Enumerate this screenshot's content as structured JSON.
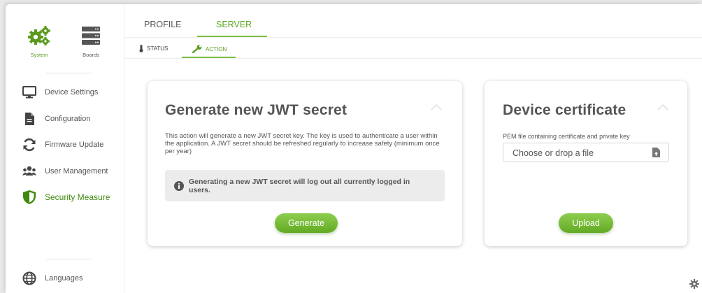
{
  "sidebar": {
    "system_label": "System",
    "boards_label": "Boards",
    "items": [
      {
        "label": "Device Settings",
        "icon": "monitor-icon"
      },
      {
        "label": "Configuration",
        "icon": "document-icon"
      },
      {
        "label": "Firmware Update",
        "icon": "refresh-icon"
      },
      {
        "label": "User Management",
        "icon": "users-icon"
      },
      {
        "label": "Security Measure",
        "icon": "shield-icon",
        "active": true
      }
    ],
    "languages_label": "Languages"
  },
  "tabs": [
    {
      "label": "PROFILE"
    },
    {
      "label": "SERVER",
      "active": true
    }
  ],
  "subtabs": [
    {
      "label": "STATUS",
      "icon": "thermometer-icon"
    },
    {
      "label": "ACTION",
      "icon": "wrench-icon",
      "active": true
    }
  ],
  "jwt_card": {
    "title": "Generate new JWT secret",
    "description": "This action will generate a new JWT secret key. The key is used to authenticate a user within the application. A JWT secret should be refreshed regularly to increase safety (minimum once per year)",
    "warning": "Generating a new JWT secret will log out all currently logged in users.",
    "button_label": "Generate"
  },
  "cert_card": {
    "title": "Device certificate",
    "field_label": "PEM file containing certificate and private key",
    "file_placeholder": "Choose or drop a file",
    "button_label": "Upload"
  },
  "colors": {
    "accent": "#5aa41c",
    "accent_dark": "#3e8a0e",
    "button": "#6db52c",
    "info_bg": "#ececec"
  }
}
